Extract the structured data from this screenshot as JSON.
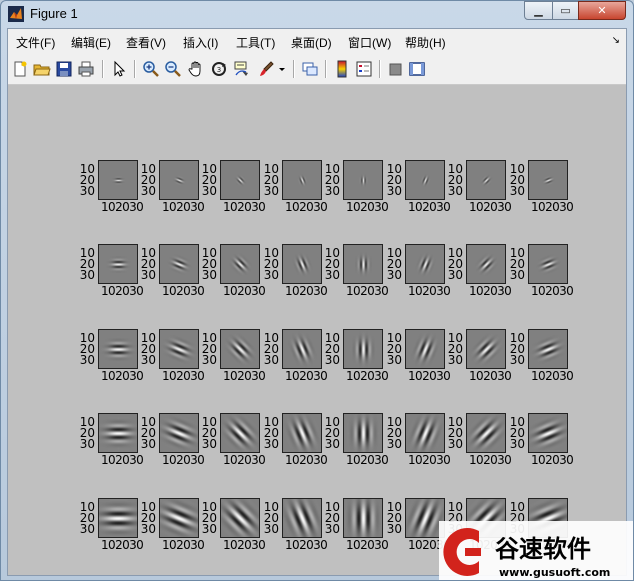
{
  "window": {
    "title": "Figure 1",
    "controls": [
      "minimize",
      "maximize",
      "close"
    ]
  },
  "menubar": {
    "items": [
      "文件(F)",
      "编辑(E)",
      "查看(V)",
      "插入(I)",
      "工具(T)",
      "桌面(D)",
      "窗口(W)",
      "帮助(H)"
    ]
  },
  "toolbar": {
    "icons": [
      "new-figure-icon",
      "open-file-icon",
      "save-icon",
      "print-icon",
      "arrow-pointer-icon",
      "zoom-in-icon",
      "zoom-out-icon",
      "pan-hand-icon",
      "rotate-3d-icon",
      "data-cursor-icon",
      "brush-icon",
      "brush-dropdown-icon",
      "link-plot-icon",
      "colorbar-icon",
      "legend-icon",
      "hide-plot-tools-icon",
      "show-plot-tools-icon"
    ]
  },
  "figure": {
    "rows": 5,
    "cols": 8,
    "ytick_labels": [
      "10",
      "20",
      "30"
    ],
    "xtick_labels": [
      "10",
      "20",
      "30"
    ],
    "orientations_deg": [
      0,
      22.5,
      45,
      67.5,
      90,
      112.5,
      135,
      157.5
    ],
    "scales": [
      1,
      2,
      3,
      4,
      5
    ]
  },
  "watermark": {
    "brand": "谷速软件",
    "url": "www.gusuoft.com"
  },
  "colors": {
    "canvas": "#c0c0c0",
    "subplot_gray": "#808080",
    "watermark_red": "#d2231c"
  }
}
